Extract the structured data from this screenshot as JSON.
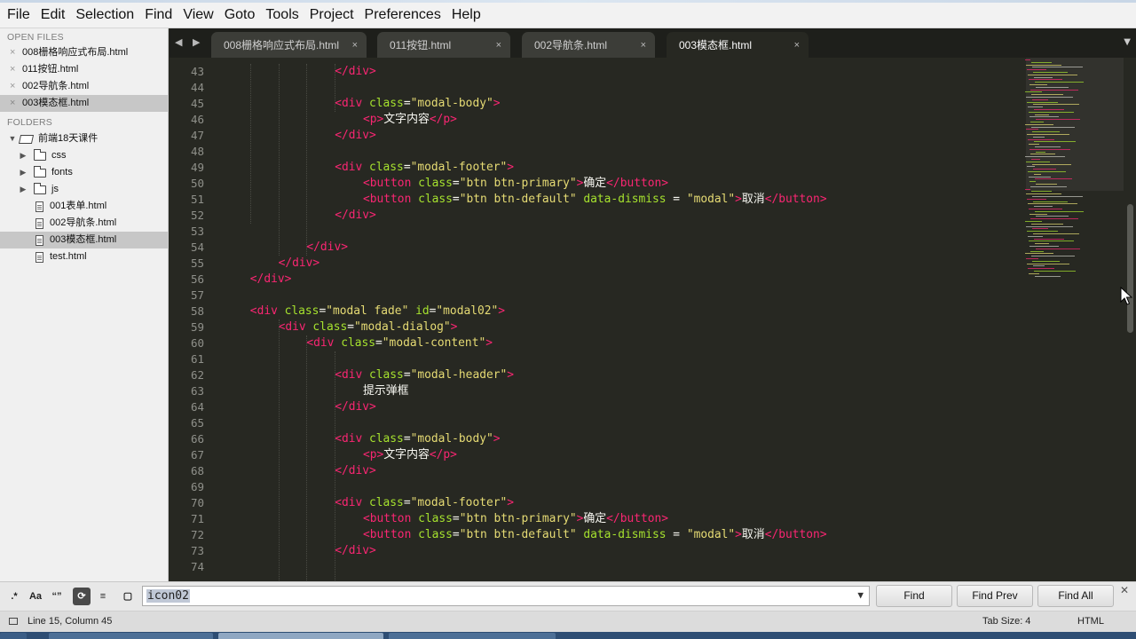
{
  "menu": [
    "File",
    "Edit",
    "Selection",
    "Find",
    "View",
    "Goto",
    "Tools",
    "Project",
    "Preferences",
    "Help"
  ],
  "sidebar": {
    "open_files_title": "OPEN FILES",
    "open_files": [
      {
        "name": "008栅格响应式布局.html",
        "active": false
      },
      {
        "name": "011按钮.html",
        "active": false
      },
      {
        "name": "002导航条.html",
        "active": false
      },
      {
        "name": "003模态框.html",
        "active": true
      }
    ],
    "folders_title": "FOLDERS",
    "root_folder": "前端18天课件",
    "subfolders": [
      "css",
      "fonts",
      "js"
    ],
    "files": [
      {
        "name": "001表单.html",
        "selected": false
      },
      {
        "name": "002导航条.html",
        "selected": false
      },
      {
        "name": "003模态框.html",
        "selected": true
      },
      {
        "name": "test.html",
        "selected": false
      }
    ]
  },
  "tabs": [
    {
      "label": "008栅格响应式布局.html",
      "active": false
    },
    {
      "label": "011按钮.html",
      "active": false
    },
    {
      "label": "002导航条.html",
      "active": false
    },
    {
      "label": "003模态框.html",
      "active": true
    }
  ],
  "editor": {
    "lines": [
      {
        "n": "43",
        "indent": 16,
        "tokens": [
          [
            "t",
            "</"
          ],
          [
            "k",
            "div"
          ],
          [
            "t",
            ">"
          ]
        ]
      },
      {
        "n": "44",
        "indent": 0,
        "tokens": []
      },
      {
        "n": "45",
        "indent": 16,
        "tokens": [
          [
            "t",
            "<"
          ],
          [
            "k",
            "div"
          ],
          [
            "x",
            " "
          ],
          [
            "a",
            "class"
          ],
          [
            "x",
            "="
          ],
          [
            "s",
            "\"modal-body\""
          ],
          [
            "t",
            ">"
          ]
        ]
      },
      {
        "n": "46",
        "indent": 20,
        "tokens": [
          [
            "t",
            "<"
          ],
          [
            "k",
            "p"
          ],
          [
            "t",
            ">"
          ],
          [
            "x",
            "文字内容"
          ],
          [
            "t",
            "</"
          ],
          [
            "k",
            "p"
          ],
          [
            "t",
            ">"
          ]
        ]
      },
      {
        "n": "47",
        "indent": 16,
        "tokens": [
          [
            "t",
            "</"
          ],
          [
            "k",
            "div"
          ],
          [
            "t",
            ">"
          ]
        ]
      },
      {
        "n": "48",
        "indent": 0,
        "tokens": []
      },
      {
        "n": "49",
        "indent": 16,
        "tokens": [
          [
            "t",
            "<"
          ],
          [
            "k",
            "div"
          ],
          [
            "x",
            " "
          ],
          [
            "a",
            "class"
          ],
          [
            "x",
            "="
          ],
          [
            "s",
            "\"modal-footer\""
          ],
          [
            "t",
            ">"
          ]
        ]
      },
      {
        "n": "50",
        "indent": 20,
        "tokens": [
          [
            "t",
            "<"
          ],
          [
            "k",
            "button"
          ],
          [
            "x",
            " "
          ],
          [
            "a",
            "class"
          ],
          [
            "x",
            "="
          ],
          [
            "s",
            "\"btn btn-primary\""
          ],
          [
            "t",
            ">"
          ],
          [
            "x",
            "确定"
          ],
          [
            "t",
            "</"
          ],
          [
            "k",
            "button"
          ],
          [
            "t",
            ">"
          ]
        ]
      },
      {
        "n": "51",
        "indent": 20,
        "tokens": [
          [
            "t",
            "<"
          ],
          [
            "k",
            "button"
          ],
          [
            "x",
            " "
          ],
          [
            "a",
            "class"
          ],
          [
            "x",
            "="
          ],
          [
            "s",
            "\"btn btn-default\""
          ],
          [
            "x",
            " "
          ],
          [
            "a",
            "data-dismiss"
          ],
          [
            "x",
            " = "
          ],
          [
            "s",
            "\"modal\""
          ],
          [
            "t",
            ">"
          ],
          [
            "x",
            "取消"
          ],
          [
            "t",
            "</"
          ],
          [
            "k",
            "button"
          ],
          [
            "t",
            ">"
          ]
        ]
      },
      {
        "n": "52",
        "indent": 16,
        "tokens": [
          [
            "t",
            "</"
          ],
          [
            "k",
            "div"
          ],
          [
            "t",
            ">"
          ]
        ]
      },
      {
        "n": "53",
        "indent": 0,
        "tokens": []
      },
      {
        "n": "54",
        "indent": 12,
        "tokens": [
          [
            "t",
            "</"
          ],
          [
            "k",
            "div"
          ],
          [
            "t",
            ">"
          ]
        ]
      },
      {
        "n": "55",
        "indent": 8,
        "tokens": [
          [
            "t",
            "</"
          ],
          [
            "k",
            "div"
          ],
          [
            "t",
            ">"
          ]
        ]
      },
      {
        "n": "56",
        "indent": 4,
        "tokens": [
          [
            "t",
            "</"
          ],
          [
            "k",
            "div"
          ],
          [
            "t",
            ">"
          ]
        ]
      },
      {
        "n": "57",
        "indent": 0,
        "tokens": []
      },
      {
        "n": "58",
        "indent": 4,
        "tokens": [
          [
            "t",
            "<"
          ],
          [
            "k",
            "div"
          ],
          [
            "x",
            " "
          ],
          [
            "a",
            "class"
          ],
          [
            "x",
            "="
          ],
          [
            "s",
            "\"modal fade\""
          ],
          [
            "x",
            " "
          ],
          [
            "a",
            "id"
          ],
          [
            "x",
            "="
          ],
          [
            "s",
            "\"modal02\""
          ],
          [
            "t",
            ">"
          ]
        ]
      },
      {
        "n": "59",
        "indent": 8,
        "tokens": [
          [
            "t",
            "<"
          ],
          [
            "k",
            "div"
          ],
          [
            "x",
            " "
          ],
          [
            "a",
            "class"
          ],
          [
            "x",
            "="
          ],
          [
            "s",
            "\"modal-dialog\""
          ],
          [
            "t",
            ">"
          ]
        ]
      },
      {
        "n": "60",
        "indent": 12,
        "tokens": [
          [
            "t",
            "<"
          ],
          [
            "k",
            "div"
          ],
          [
            "x",
            " "
          ],
          [
            "a",
            "class"
          ],
          [
            "x",
            "="
          ],
          [
            "s",
            "\"modal-content\""
          ],
          [
            "t",
            ">"
          ]
        ]
      },
      {
        "n": "61",
        "indent": 0,
        "tokens": []
      },
      {
        "n": "62",
        "indent": 16,
        "tokens": [
          [
            "t",
            "<"
          ],
          [
            "k",
            "div"
          ],
          [
            "x",
            " "
          ],
          [
            "a",
            "class"
          ],
          [
            "x",
            "="
          ],
          [
            "s",
            "\"modal-header\""
          ],
          [
            "t",
            ">"
          ]
        ]
      },
      {
        "n": "63",
        "indent": 20,
        "tokens": [
          [
            "x",
            "提示弹框"
          ]
        ]
      },
      {
        "n": "64",
        "indent": 16,
        "tokens": [
          [
            "t",
            "</"
          ],
          [
            "k",
            "div"
          ],
          [
            "t",
            ">"
          ]
        ]
      },
      {
        "n": "65",
        "indent": 0,
        "tokens": []
      },
      {
        "n": "66",
        "indent": 16,
        "tokens": [
          [
            "t",
            "<"
          ],
          [
            "k",
            "div"
          ],
          [
            "x",
            " "
          ],
          [
            "a",
            "class"
          ],
          [
            "x",
            "="
          ],
          [
            "s",
            "\"modal-body\""
          ],
          [
            "t",
            ">"
          ]
        ]
      },
      {
        "n": "67",
        "indent": 20,
        "tokens": [
          [
            "t",
            "<"
          ],
          [
            "k",
            "p"
          ],
          [
            "t",
            ">"
          ],
          [
            "x",
            "文字内容"
          ],
          [
            "t",
            "</"
          ],
          [
            "k",
            "p"
          ],
          [
            "t",
            ">"
          ]
        ]
      },
      {
        "n": "68",
        "indent": 16,
        "tokens": [
          [
            "t",
            "</"
          ],
          [
            "k",
            "div"
          ],
          [
            "t",
            ">"
          ]
        ]
      },
      {
        "n": "69",
        "indent": 0,
        "tokens": []
      },
      {
        "n": "70",
        "indent": 16,
        "tokens": [
          [
            "t",
            "<"
          ],
          [
            "k",
            "div"
          ],
          [
            "x",
            " "
          ],
          [
            "a",
            "class"
          ],
          [
            "x",
            "="
          ],
          [
            "s",
            "\"modal-footer\""
          ],
          [
            "t",
            ">"
          ]
        ]
      },
      {
        "n": "71",
        "indent": 20,
        "tokens": [
          [
            "t",
            "<"
          ],
          [
            "k",
            "button"
          ],
          [
            "x",
            " "
          ],
          [
            "a",
            "class"
          ],
          [
            "x",
            "="
          ],
          [
            "s",
            "\"btn btn-primary\""
          ],
          [
            "t",
            ">"
          ],
          [
            "x",
            "确定"
          ],
          [
            "t",
            "</"
          ],
          [
            "k",
            "button"
          ],
          [
            "t",
            ">"
          ]
        ]
      },
      {
        "n": "72",
        "indent": 20,
        "tokens": [
          [
            "t",
            "<"
          ],
          [
            "k",
            "button"
          ],
          [
            "x",
            " "
          ],
          [
            "a",
            "class"
          ],
          [
            "x",
            "="
          ],
          [
            "s",
            "\"btn btn-default\""
          ],
          [
            "x",
            " "
          ],
          [
            "a",
            "data-dismiss"
          ],
          [
            "x",
            " = "
          ],
          [
            "s",
            "\"modal\""
          ],
          [
            "t",
            ">"
          ],
          [
            "x",
            "取消"
          ],
          [
            "t",
            "</"
          ],
          [
            "k",
            "button"
          ],
          [
            "t",
            ">"
          ]
        ]
      },
      {
        "n": "73",
        "indent": 16,
        "tokens": [
          [
            "t",
            "</"
          ],
          [
            "k",
            "div"
          ],
          [
            "t",
            ">"
          ]
        ]
      },
      {
        "n": "74",
        "indent": 0,
        "tokens": []
      }
    ]
  },
  "find": {
    "value": "icon02",
    "find_label": "Find",
    "find_prev_label": "Find Prev",
    "find_all_label": "Find All"
  },
  "status": {
    "position": "Line 15, Column 45",
    "tab_size": "Tab Size: 4",
    "syntax": "HTML"
  },
  "colors": {
    "editor_bg": "#272822",
    "tag": "#f92672",
    "attribute": "#a6e22e",
    "string": "#e6db74",
    "text": "#f8f8f2"
  }
}
